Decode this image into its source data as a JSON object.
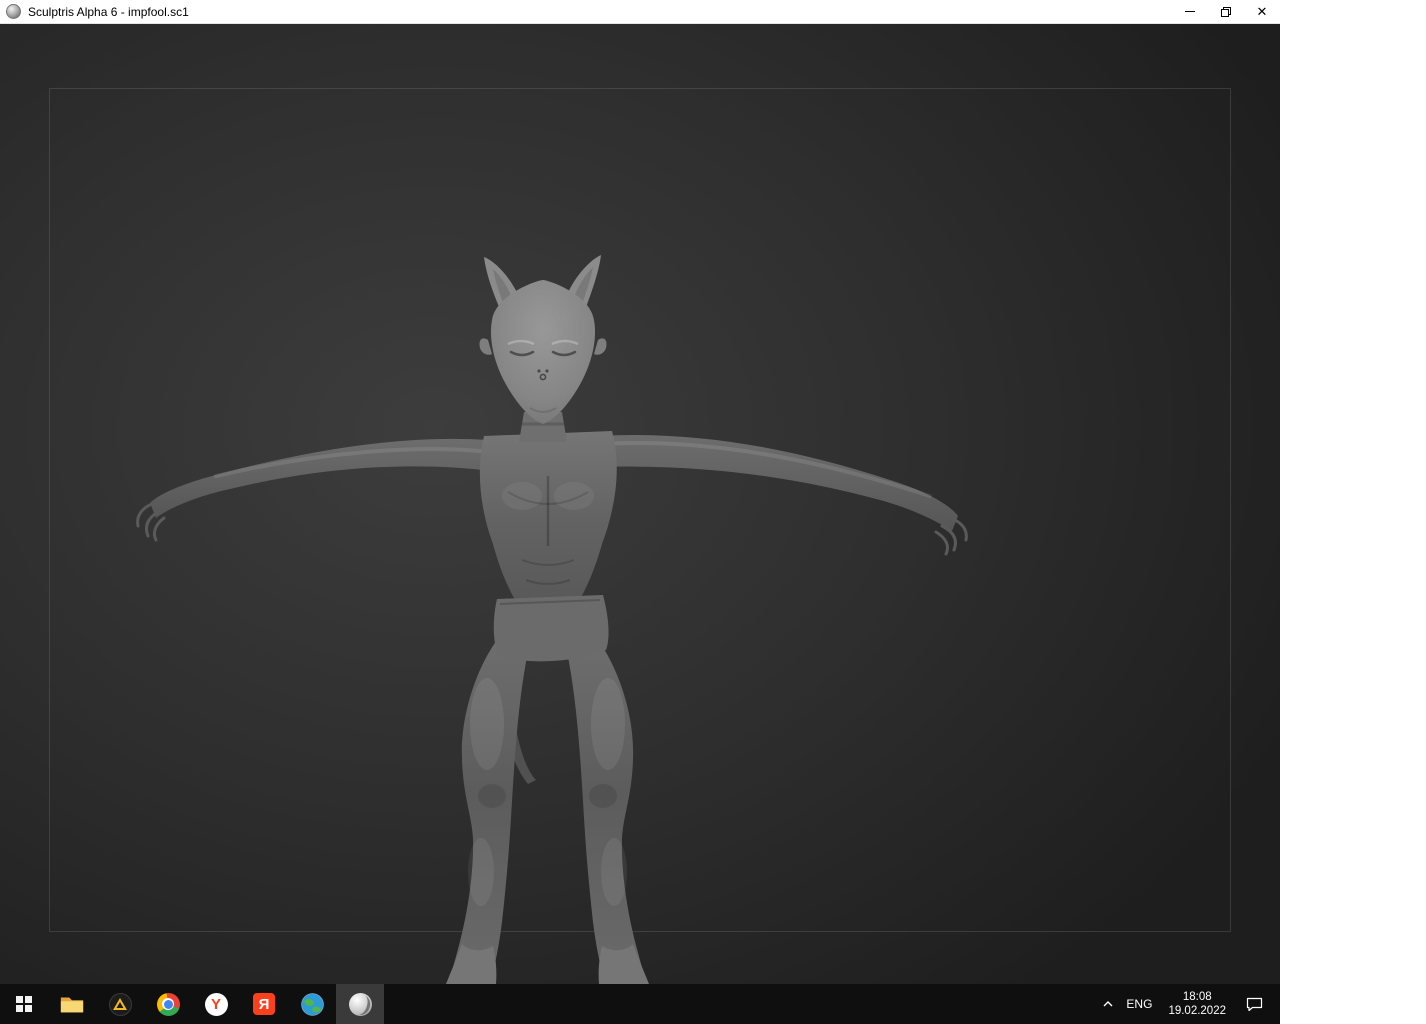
{
  "window": {
    "title": "Sculptris Alpha 6 - impfool.sc1"
  },
  "titlebar": {
    "app_icon": "sculptris-sphere-icon",
    "controls": {
      "minimize": "minimize-button",
      "restore": "restore-button",
      "close": "close-button"
    }
  },
  "viewport": {
    "content": "3d-sculpt-model-imp-tpose",
    "background_color": "#2e2e2e",
    "model_color": "#666666"
  },
  "taskbar": {
    "background_color": "#0f0f0f",
    "items": [
      {
        "name": "start",
        "icon": "windows-logo-icon"
      },
      {
        "name": "file-explorer",
        "icon": "folder-icon"
      },
      {
        "name": "dark-app",
        "icon": "dark-circle-yellow-triangle-icon"
      },
      {
        "name": "chrome",
        "icon": "chrome-icon"
      },
      {
        "name": "yandex-browser",
        "icon": "yandex-y-icon",
        "letter": "Y"
      },
      {
        "name": "yandex-app",
        "icon": "yandex-ya-icon",
        "letter": "Я"
      },
      {
        "name": "globe-app",
        "icon": "globe-icon"
      },
      {
        "name": "sculptris",
        "icon": "sculptris-sphere-icon",
        "active": true
      }
    ],
    "tray": {
      "chevron_icon": "chevron-up-icon",
      "language": "ENG",
      "time": "18:08",
      "date": "19.02.2022",
      "notification_icon": "comment-bubble-icon"
    }
  },
  "colors": {
    "yandex_red": "#fc3f1d",
    "folder_yellow": "#f8d775",
    "chrome_red": "#ea4335",
    "chrome_yellow": "#fbbc05",
    "chrome_green": "#34a853",
    "chrome_blue": "#4285f4",
    "titlebar": "#ffffff",
    "taskbar": "#0f0f0f"
  }
}
